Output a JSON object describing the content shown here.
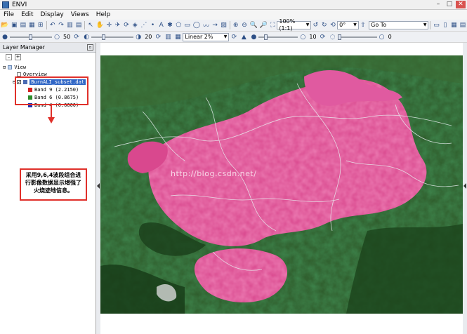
{
  "window": {
    "title": "ENVI"
  },
  "menu": [
    "File",
    "Edit",
    "Display",
    "Views",
    "Help"
  ],
  "toolbar": {
    "zoom_value": "100% (1:1)",
    "rotation_value": "0°",
    "goto_value": "Go To"
  },
  "toolbar2": {
    "brightness_value": "50",
    "contrast_value": "20",
    "stretch_value": "Linear 2%",
    "sharpen_value": "10",
    "transparency_value": "0"
  },
  "layer_manager": {
    "title": "Layer Manager",
    "view_label": "View",
    "overview_label": "Overview",
    "file_label": "BurnALI_subset.dat",
    "bands": [
      {
        "label": "Band 9 (2.2150)",
        "color": "#d42020"
      },
      {
        "label": "Band 6 (0.8675)",
        "color": "#2a8a2a"
      },
      {
        "label": "Band 4 (0.6600)",
        "color": "#2030b0"
      }
    ]
  },
  "annotation": {
    "text": "采用9,6,4波段组合进行影像数据显示增强了火烧迹地信息。",
    "color": "#e0302a"
  },
  "image": {
    "watermark": "http://blog.csdn.net/"
  }
}
